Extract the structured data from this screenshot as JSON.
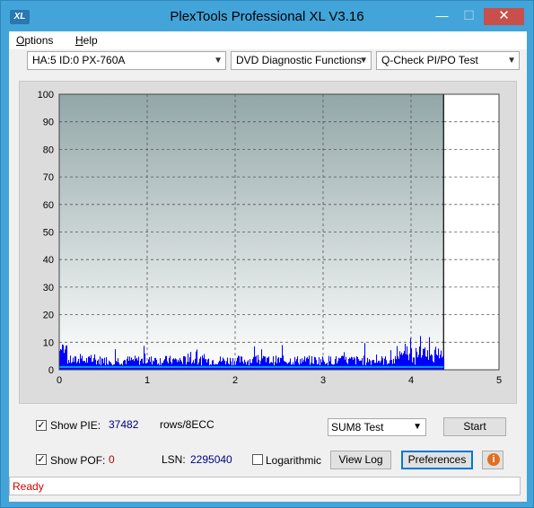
{
  "window": {
    "title": "PlexTools Professional XL V3.16",
    "icon_label": "XL",
    "min_glyph": "—",
    "max_glyph": "☐",
    "close_glyph": "✕"
  },
  "menu": {
    "items": [
      "Options",
      "Help"
    ]
  },
  "toolbar": {
    "drive": "HA:5 ID:0  PX-760A",
    "function": "DVD Diagnostic Functions",
    "test": "Q-Check PI/PO Test"
  },
  "chart_data": {
    "type": "bar",
    "xlim": [
      0,
      5
    ],
    "ylim": [
      0,
      100
    ],
    "x_ticks": [
      "0",
      "1",
      "2",
      "3",
      "4",
      "5"
    ],
    "y_ticks": [
      "0",
      "10",
      "20",
      "30",
      "40",
      "50",
      "60",
      "70",
      "80",
      "90",
      "100"
    ],
    "grid": true,
    "disc_end_x": 4.37,
    "series": [
      {
        "color": "#0000ff",
        "x_start": 0,
        "x_end": 4.37,
        "typical_y": 4,
        "peak_y": 12
      },
      {
        "color": "#00a0ff",
        "x_start": 0,
        "x_end": 4.37,
        "typical_y": 1
      }
    ]
  },
  "colors": {
    "pie": "#0000ff",
    "poe": "#00a0ff",
    "status": "#d00000"
  },
  "controls": {
    "show_pie_label": "Show PIE:",
    "pie_value": "37482",
    "pie_unit": "rows/8ECC",
    "show_poe_label": "Show POF:",
    "poe_value": "0",
    "lsn_label": "LSN:",
    "lsn_value": "2295040",
    "logarithmic_label": "Logarithmic",
    "sum_select": "SUM8 Test",
    "start_button": "Start",
    "view_log_button": "View Log",
    "preferences_button": "Preferences"
  },
  "status": {
    "text": "Ready"
  }
}
